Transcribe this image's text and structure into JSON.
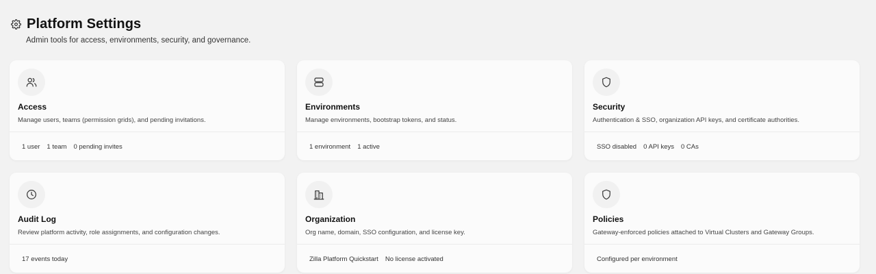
{
  "header": {
    "title": "Platform Settings",
    "subtitle": "Admin tools for access, environments, security, and governance.",
    "icon": "gear-icon"
  },
  "cards": [
    {
      "id": "access",
      "icon": "users-icon",
      "title": "Access",
      "description": "Manage users, teams (permission grids), and pending invitations.",
      "stats": [
        "1 user",
        "1 team",
        "0 pending invites"
      ]
    },
    {
      "id": "environments",
      "icon": "server-icon",
      "title": "Environments",
      "description": "Manage environments, bootstrap tokens, and status.",
      "stats": [
        "1 environment",
        "1 active"
      ]
    },
    {
      "id": "security",
      "icon": "shield-icon",
      "title": "Security",
      "description": "Authentication & SSO, organization API keys, and certificate authorities.",
      "stats": [
        "SSO disabled",
        "0 API keys",
        "0 CAs"
      ]
    },
    {
      "id": "audit-log",
      "icon": "clock-icon",
      "title": "Audit Log",
      "description": "Review platform activity, role assignments, and configuration changes.",
      "stats": [
        "17 events today"
      ]
    },
    {
      "id": "organization",
      "icon": "building-icon",
      "title": "Organization",
      "description": "Org name, domain, SSO configuration, and license key.",
      "stats": [
        "Zilla Platform Quickstart",
        "No license activated"
      ]
    },
    {
      "id": "policies",
      "icon": "shield-icon",
      "title": "Policies",
      "description": "Gateway-enforced policies attached to Virtual Clusters and Gateway Groups.",
      "stats": [
        "Configured per environment"
      ]
    }
  ]
}
